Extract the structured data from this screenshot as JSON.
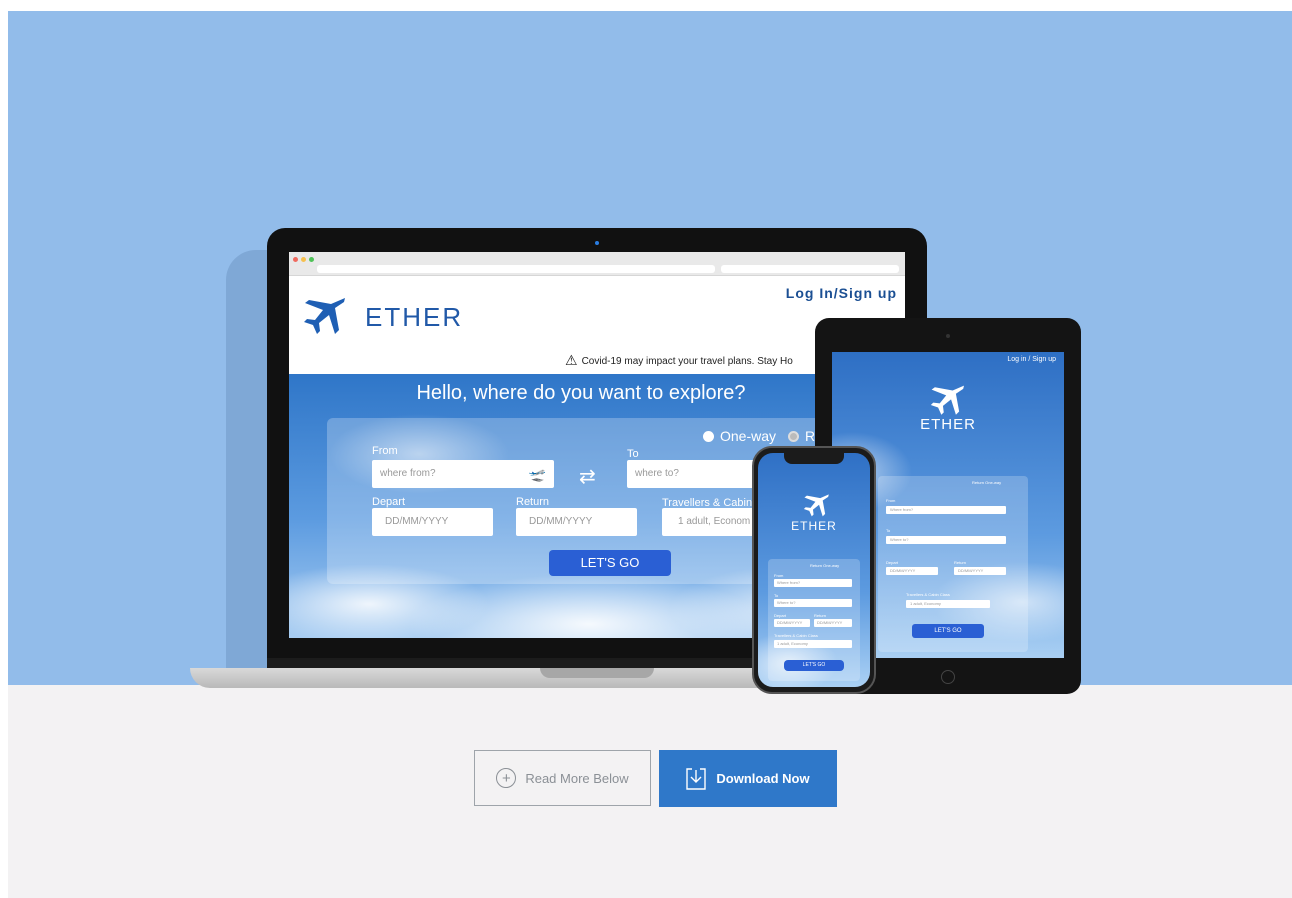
{
  "laptop": {
    "login_link": "Log In/Sign up",
    "brand": "ETHER",
    "notice": "Covid-19 may impact your travel plans.  Stay Ho",
    "headline": "Hello, where do you want to explore?",
    "trip_one_way": "One-way",
    "trip_round": "R",
    "from_label": "From",
    "from_placeholder": "where from?",
    "to_label": "To",
    "to_placeholder": "where to?",
    "depart_label": "Depart",
    "depart_placeholder": "DD/MM/YYYY",
    "return_label": "Return",
    "return_placeholder": "DD/MM/YYYY",
    "travellers_label": "Travellers & Cabin",
    "travellers_value": "1 adult, Econom",
    "go_button": "LET'S GO"
  },
  "tablet": {
    "login_link": "Log in / Sign up",
    "brand": "ETHER",
    "trip_options": "Return  One-way",
    "from_label": "From",
    "from_placeholder": "Where from?",
    "to_label": "To",
    "to_placeholder": "Where to?",
    "depart_label": "Depart",
    "depart_placeholder": "DD/MM/YYYY",
    "return_label": "Return",
    "return_placeholder": "DD/MM/YYYY",
    "travellers_label": "Travellers & Cabin Class",
    "travellers_value": "1 adult, Economy",
    "go_button": "LET'S GO"
  },
  "phone": {
    "brand": "ETHER",
    "trip_options": "Return  One-way",
    "from_label": "From",
    "from_placeholder": "Where from?",
    "to_label": "To",
    "to_placeholder": "Where to?",
    "depart_label": "Depart",
    "depart_placeholder": "DD/MM/YYYY",
    "return_label": "Return",
    "return_placeholder": "DD/MM/YYYY",
    "travellers_label": "Travellers & Cabin Class",
    "travellers_value": "1 adult, Economy",
    "go_button": "LET'S GO"
  },
  "actions": {
    "read_more": "Read More Below",
    "download": "Download Now"
  },
  "colors": {
    "hero_bg": "#92bcea",
    "lower_bg": "#f3f2f3",
    "brand_blue": "#2159a8",
    "download_button": "#2f78c9",
    "go_button": "#2a5fd4"
  },
  "icons": [
    "plane-icon",
    "warning-icon",
    "takeoff-icon",
    "swap-icon",
    "landing-icon",
    "plus-circle-icon",
    "download-icon"
  ]
}
